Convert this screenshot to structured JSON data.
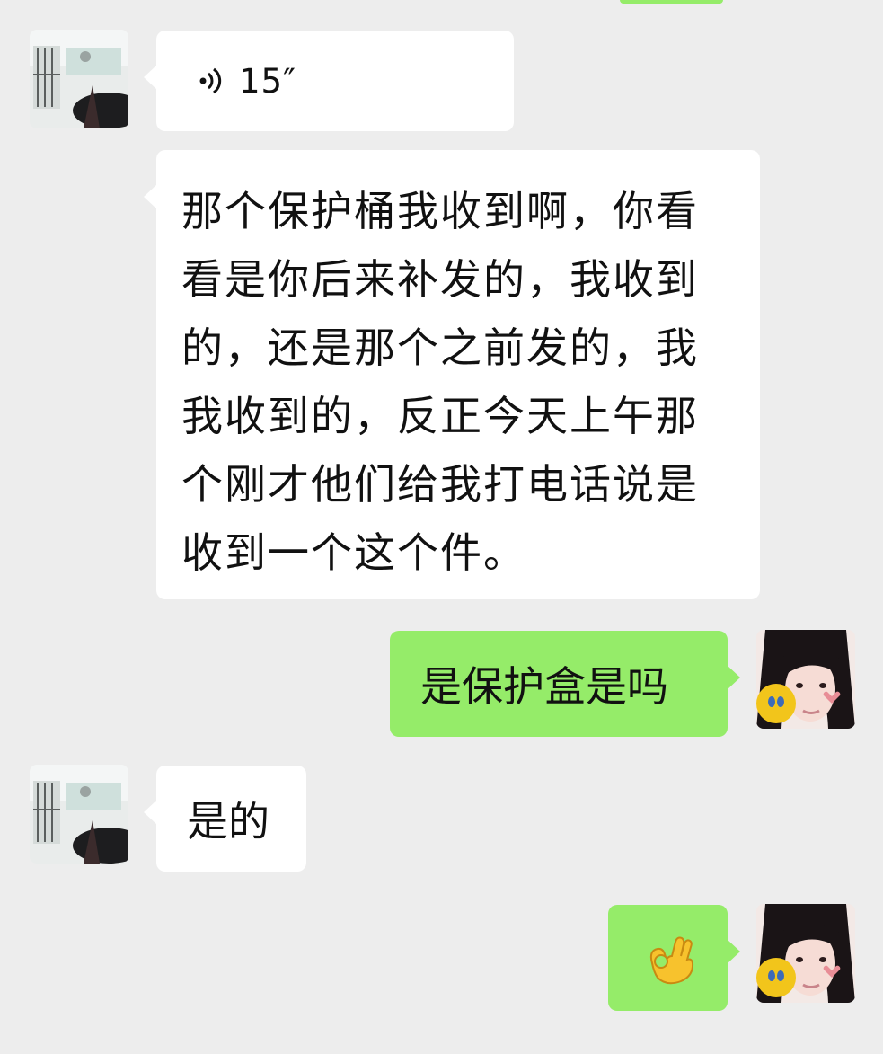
{
  "chat": {
    "messages": [
      {
        "id": "m1",
        "sender": "contact",
        "type": "voice",
        "duration": "15″",
        "icon": "voice-wave-icon"
      },
      {
        "id": "m2",
        "sender": "contact",
        "type": "text",
        "text": "那个保护桶我收到啊，你看看是你后来补发的，我收到的，还是那个之前发的，我我收到的，反正今天上午那个刚才他们给我打电话说是收到一个这个件。"
      },
      {
        "id": "m3",
        "sender": "me",
        "type": "text",
        "text": "是保护盒是吗"
      },
      {
        "id": "m4",
        "sender": "contact",
        "type": "text",
        "text": "是的"
      },
      {
        "id": "m5",
        "sender": "me",
        "type": "emoji",
        "emoji": "👌",
        "icon": "ok-hand-emoji"
      }
    ]
  },
  "colors": {
    "background": "#ededed",
    "incoming_bubble": "#ffffff",
    "outgoing_bubble": "#95ec69"
  }
}
